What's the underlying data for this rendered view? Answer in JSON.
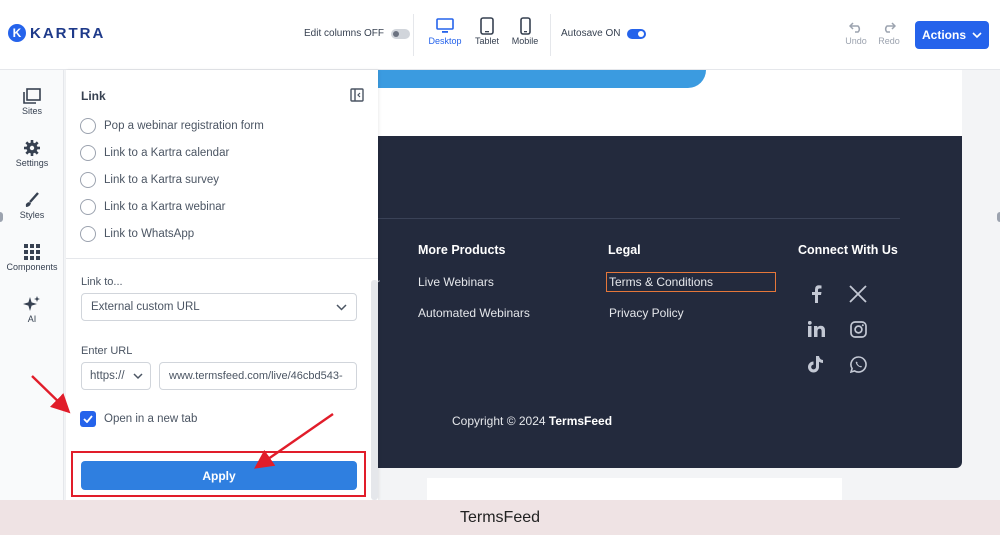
{
  "header": {
    "logo_text": "KARTRA",
    "logo_mark": "K",
    "edit_columns_label": "Edit columns OFF",
    "devices": [
      {
        "label": "Desktop",
        "icon": "desktop-icon",
        "active": true
      },
      {
        "label": "Tablet",
        "icon": "tablet-icon",
        "active": false
      },
      {
        "label": "Mobile",
        "icon": "mobile-icon",
        "active": false
      }
    ],
    "autosave_label": "Autosave ON",
    "undo_label": "Undo",
    "redo_label": "Redo",
    "actions_label": "Actions"
  },
  "sidebar": {
    "items": [
      {
        "label": "Sites",
        "icon": "sites-icon"
      },
      {
        "label": "Settings",
        "icon": "gear-icon"
      },
      {
        "label": "Styles",
        "icon": "brush-icon"
      },
      {
        "label": "Components",
        "icon": "grid-icon"
      },
      {
        "label": "AI",
        "icon": "sparkle-icon"
      }
    ]
  },
  "link_panel": {
    "title": "Link",
    "options": [
      "Pop a webinar registration form",
      "Link to a Kartra calendar",
      "Link to a Kartra survey",
      "Link to a Kartra webinar",
      "Link to WhatsApp"
    ],
    "link_to_label": "Link to...",
    "link_to_value": "External custom URL",
    "enter_url_label": "Enter URL",
    "protocol_value": "https://",
    "url_value": "www.termsfeed.com/live/46cbd543-",
    "open_new_tab_label": "Open in a new tab",
    "open_new_tab_checked": true,
    "apply_label": "Apply"
  },
  "footer": {
    "partial_text": "r",
    "columns": [
      {
        "heading": "More Products",
        "links": [
          "Live Webinars",
          "Automated Webinars"
        ]
      },
      {
        "heading": "Legal",
        "links": [
          "Terms & Conditions",
          "Privacy Policy"
        ]
      },
      {
        "heading": "Connect With Us",
        "icons": [
          "facebook-icon",
          "x-icon",
          "linkedin-icon",
          "instagram-icon",
          "tiktok-icon",
          "whatsapp-icon"
        ]
      }
    ],
    "copyright_prefix": "Copyright © 2024",
    "copyright_brand": "TermsFeed"
  },
  "caption": "TermsFeed",
  "colors": {
    "accent": "#2563eb",
    "footer_bg": "#232a3d",
    "highlight": "#e11d2a",
    "terms_outline": "#e5773a"
  }
}
